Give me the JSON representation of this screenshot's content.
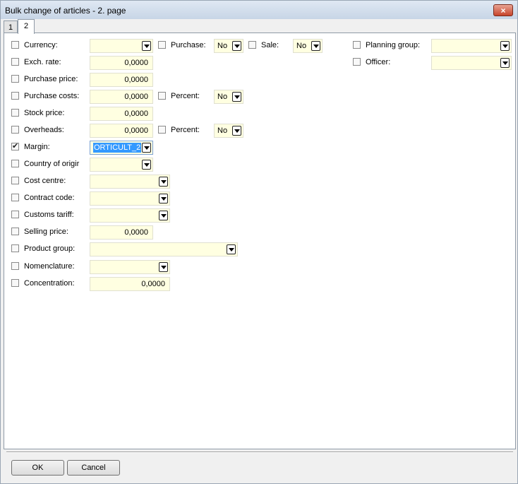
{
  "window": {
    "title": "Bulk change of articles - 2. page",
    "close_icon": "×"
  },
  "tabs": [
    {
      "label": "1"
    },
    {
      "label": "2"
    }
  ],
  "fields": {
    "currency": {
      "label": "Currency:",
      "value": ""
    },
    "purchase": {
      "label": "Purchase:",
      "value": "No"
    },
    "sale": {
      "label": "Sale:",
      "value": "No"
    },
    "planning_group": {
      "label": "Planning group:",
      "value": ""
    },
    "exch_rate": {
      "label": "Exch. rate:",
      "value": "0,0000"
    },
    "officer": {
      "label": "Officer:",
      "value": ""
    },
    "purchase_price": {
      "label": "Purchase price:",
      "value": "0,0000"
    },
    "purchase_costs": {
      "label": "Purchase costs:",
      "value": "0,0000"
    },
    "purchase_costs_percent": {
      "label": "Percent:",
      "value": "No"
    },
    "stock_price": {
      "label": "Stock price:",
      "value": "0,0000"
    },
    "overheads": {
      "label": "Overheads:",
      "value": "0,0000"
    },
    "overheads_percent": {
      "label": "Percent:",
      "value": "No"
    },
    "margin": {
      "label": "Margin:",
      "value": "ORTICULT_2",
      "checked": true
    },
    "country_of_origin": {
      "label": "Country of origir",
      "value": ""
    },
    "cost_centre": {
      "label": "Cost centre:",
      "value": ""
    },
    "contract_code": {
      "label": "Contract code:",
      "value": ""
    },
    "customs_tariff": {
      "label": "Customs tariff:",
      "value": ""
    },
    "selling_price": {
      "label": "Selling price:",
      "value": "0,0000"
    },
    "product_group": {
      "label": "Product group:",
      "value": ""
    },
    "nomenclature": {
      "label": "Nomenclature:",
      "value": ""
    },
    "concentration": {
      "label": "Concentration:",
      "value": "0,0000"
    }
  },
  "buttons": {
    "ok": "OK",
    "cancel": "Cancel"
  },
  "colors": {
    "field_bg": "#ffffe1",
    "selection": "#3399ff",
    "close_btn": "#c7432a"
  }
}
